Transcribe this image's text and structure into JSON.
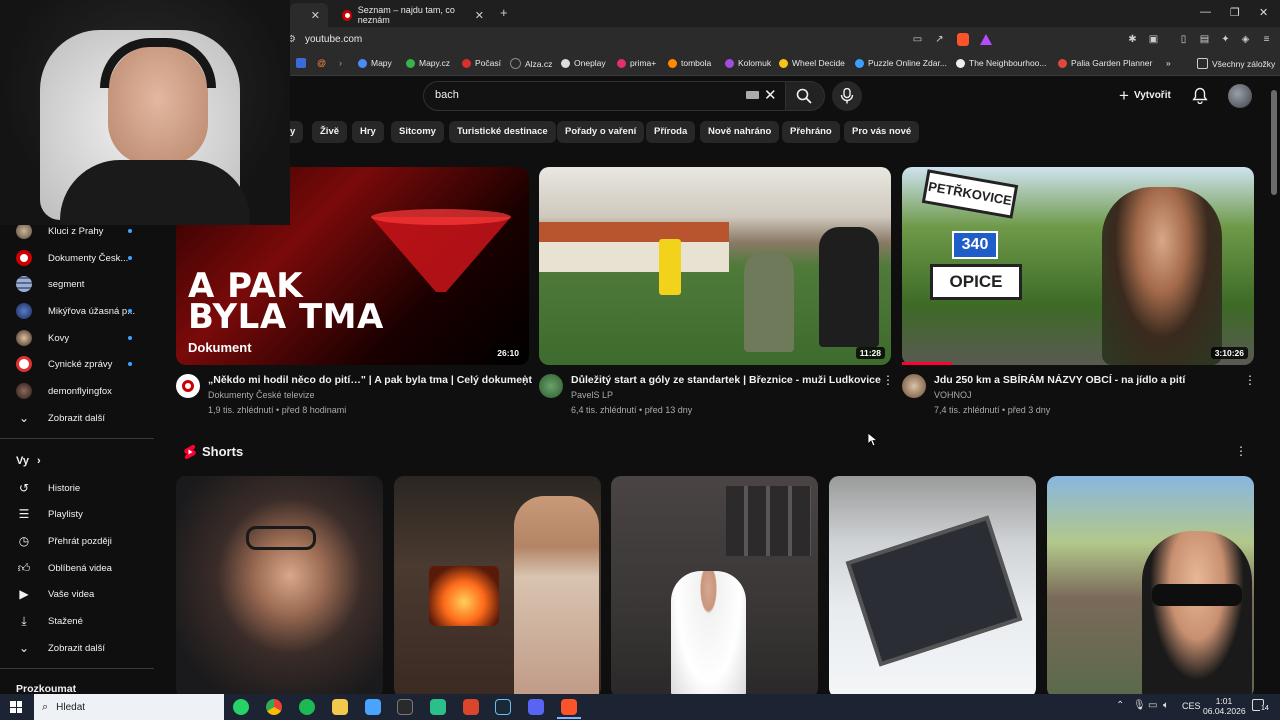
{
  "browser": {
    "tab1_title": "Seznam – najdu tam, co neznám",
    "new_tab": "+",
    "url": "youtube.com",
    "bookmarks": [
      "Mapy",
      "Mapy.cz",
      "Počasí",
      "Alza.cz",
      "Oneplay",
      "prima+",
      "tombola",
      "Kolomuk",
      "Wheel Decide",
      "Puzzle Online Zdar...",
      "The Neighbourhoo...",
      "Palia Garden Planner"
    ],
    "bookmarks_more": "»",
    "all_bookmarks": "Všechny záložky"
  },
  "youtube": {
    "search_query": "bach",
    "create_label": "Vytvořit",
    "chips": [
      "y",
      "Živě",
      "Hry",
      "Sitcomy",
      "Turistické destinace",
      "Pořady o vaření",
      "Příroda",
      "Nově nahráno",
      "Přehráno",
      "Pro vás nové"
    ],
    "videos": [
      {
        "title": "„Někdo mi hodil něco do pití…\" | A pak byla tma | Celý dokument",
        "channel": "Dokumenty České televize",
        "meta": "1,9 tis. zhlédnutí • před 8 hodinami",
        "duration": "26:10",
        "thumb_line1": "A PAK",
        "thumb_line2": "BYLA TMA",
        "thumb_sub": "Dokument"
      },
      {
        "title": "Důležitý start a góly ze standartek  |  Březnice - muži Ludkovice",
        "channel": "PavelS LP",
        "meta": "6,4 tis. zhlédnutí • před 13 dny",
        "duration": "11:28"
      },
      {
        "title": "Jdu 250 km a SBÍRÁM NÁZVY OBCÍ - na jídlo a pití",
        "channel": "VOHNOJ",
        "meta": "7,4 tis. zhlédnutí • před 3 dny",
        "duration": "3:10:26",
        "sign_top": "PETŘKOVICE",
        "sign_num": "340",
        "sign_bottom": "OPICE"
      }
    ],
    "shorts_heading": "Shorts",
    "sidebar": {
      "subscriptions": [
        "Kluci z Prahy",
        "Dokumenty Česk...",
        "segment",
        "Mikýřova úžasná p...",
        "Kovy",
        "Cynické zprávy",
        "demonflyingfox"
      ],
      "show_more": "Zobrazit další",
      "you_heading": "Vy",
      "you_items": [
        "Historie",
        "Playlisty",
        "Přehrát později",
        "Oblíbená videa",
        "Vaše videa",
        "Stažené",
        "Zobrazit další"
      ],
      "explore_heading": "Prozkoumat"
    }
  },
  "taskbar": {
    "search_placeholder": "Hledat",
    "lang": "CES",
    "time": "1:01",
    "date": "06.04.2026",
    "notif_count": "14"
  },
  "colors": {
    "yt_bg": "#0f0f0f",
    "chip_bg": "#272727",
    "accent_red": "#ff0033",
    "live_blue": "#3ea6ff"
  }
}
